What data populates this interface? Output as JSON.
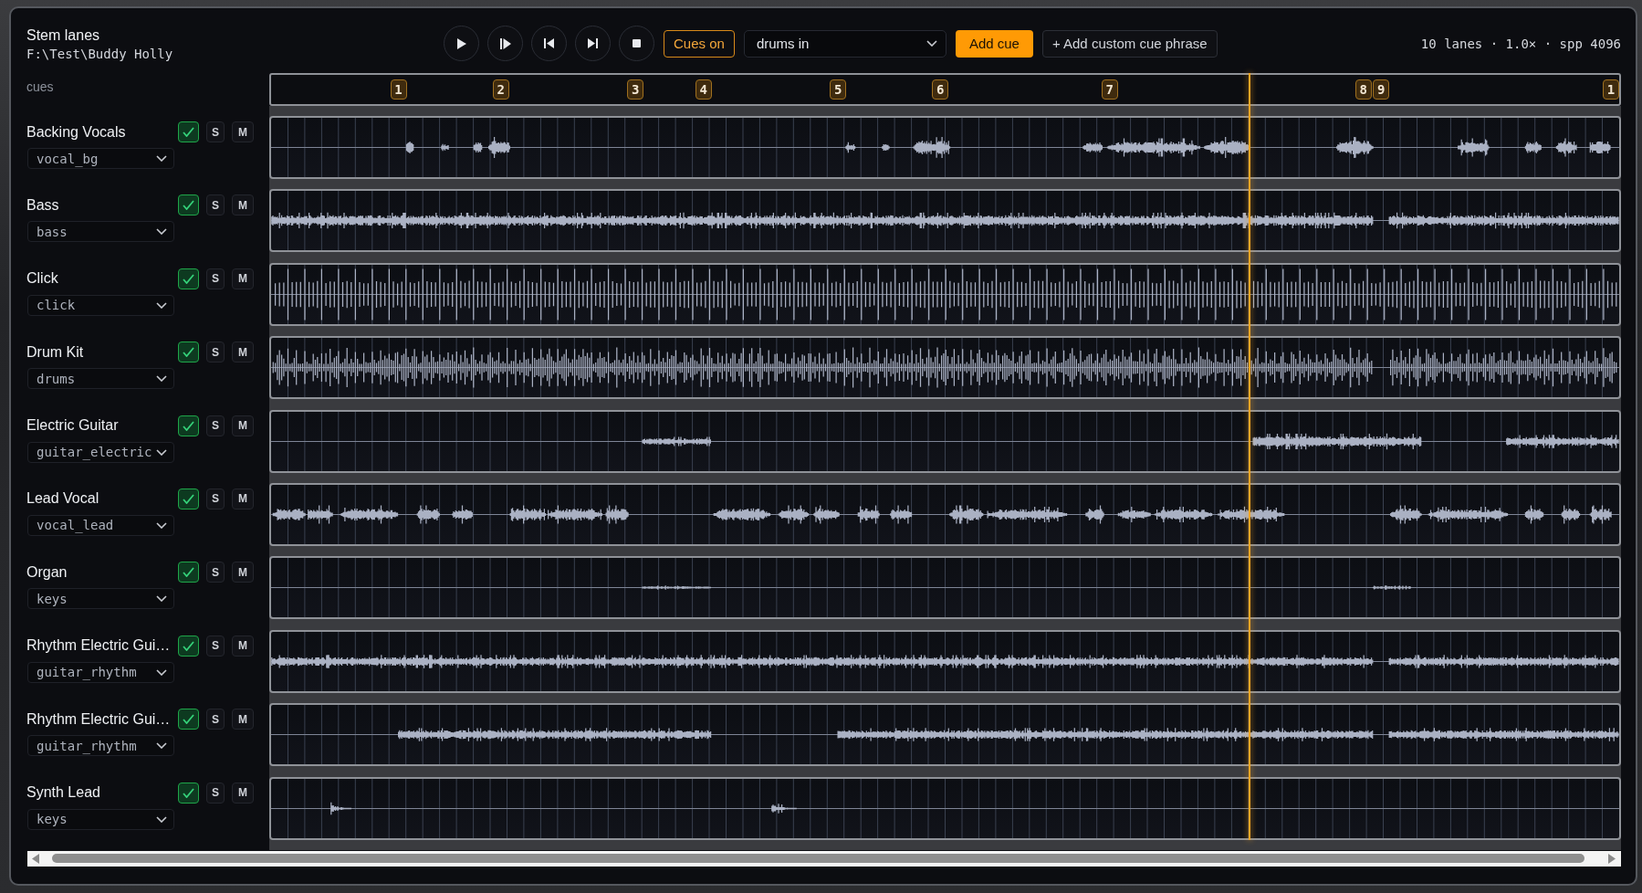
{
  "header": {
    "title": "Stem lanes",
    "path": "F:\\Test\\Buddy Holly"
  },
  "toolbar": {
    "transport": [
      {
        "kind": "play"
      },
      {
        "kind": "step"
      },
      {
        "kind": "previous"
      },
      {
        "kind": "next"
      },
      {
        "kind": "stop"
      }
    ],
    "cues_toggle": {
      "label": "Cues on",
      "on": true
    },
    "cue_select": {
      "value": "drums in"
    },
    "add_cue": "Add cue",
    "add_custom": "+ Add custom cue phrase"
  },
  "info": "10 lanes · 1.0× · spp 4096",
  "cues": {
    "label": "cues",
    "markers": [
      "1",
      "2",
      "3",
      "4",
      "5",
      "6",
      "7",
      "8",
      "9",
      "1"
    ]
  },
  "playback": {
    "level": 0.725
  },
  "lanes": [
    {
      "name": "Backing Vocals",
      "enabled": true,
      "solo": {
        "label": "S",
        "on": false
      },
      "mute": {
        "label": "M",
        "on": false
      },
      "stem": "vocal_bg"
    },
    {
      "name": "Bass",
      "enabled": true,
      "solo": {
        "label": "S",
        "on": false
      },
      "mute": {
        "label": "M",
        "on": false
      },
      "stem": "bass"
    },
    {
      "name": "Click",
      "enabled": true,
      "solo": {
        "label": "S",
        "on": false
      },
      "mute": {
        "label": "M",
        "on": false
      },
      "stem": "click"
    },
    {
      "name": "Drum Kit",
      "enabled": true,
      "solo": {
        "label": "S",
        "on": false
      },
      "mute": {
        "label": "M",
        "on": false
      },
      "stem": "drums"
    },
    {
      "name": "Electric Guitar",
      "enabled": true,
      "solo": {
        "label": "S",
        "on": false
      },
      "mute": {
        "label": "M",
        "on": false
      },
      "stem": "guitar_electric"
    },
    {
      "name": "Lead Vocal",
      "enabled": true,
      "solo": {
        "label": "S",
        "on": false
      },
      "mute": {
        "label": "M",
        "on": false
      },
      "stem": "vocal_lead"
    },
    {
      "name": "Organ",
      "enabled": true,
      "solo": {
        "label": "S",
        "on": false
      },
      "mute": {
        "label": "M",
        "on": false
      },
      "stem": "keys"
    },
    {
      "name": "Rhythm Electric Gui…",
      "enabled": true,
      "solo": {
        "label": "S",
        "on": false
      },
      "mute": {
        "label": "M",
        "on": false
      },
      "stem": "guitar_rhythm"
    },
    {
      "name": "Rhythm Electric Gui…",
      "enabled": true,
      "solo": {
        "label": "S",
        "on": false
      },
      "mute": {
        "label": "M",
        "on": false
      },
      "stem": "guitar_rhythm"
    },
    {
      "name": "Synth Lead",
      "enabled": true,
      "solo": {
        "label": "S",
        "on": false
      },
      "mute": {
        "label": "M",
        "on": false
      },
      "stem": "keys"
    }
  ]
}
